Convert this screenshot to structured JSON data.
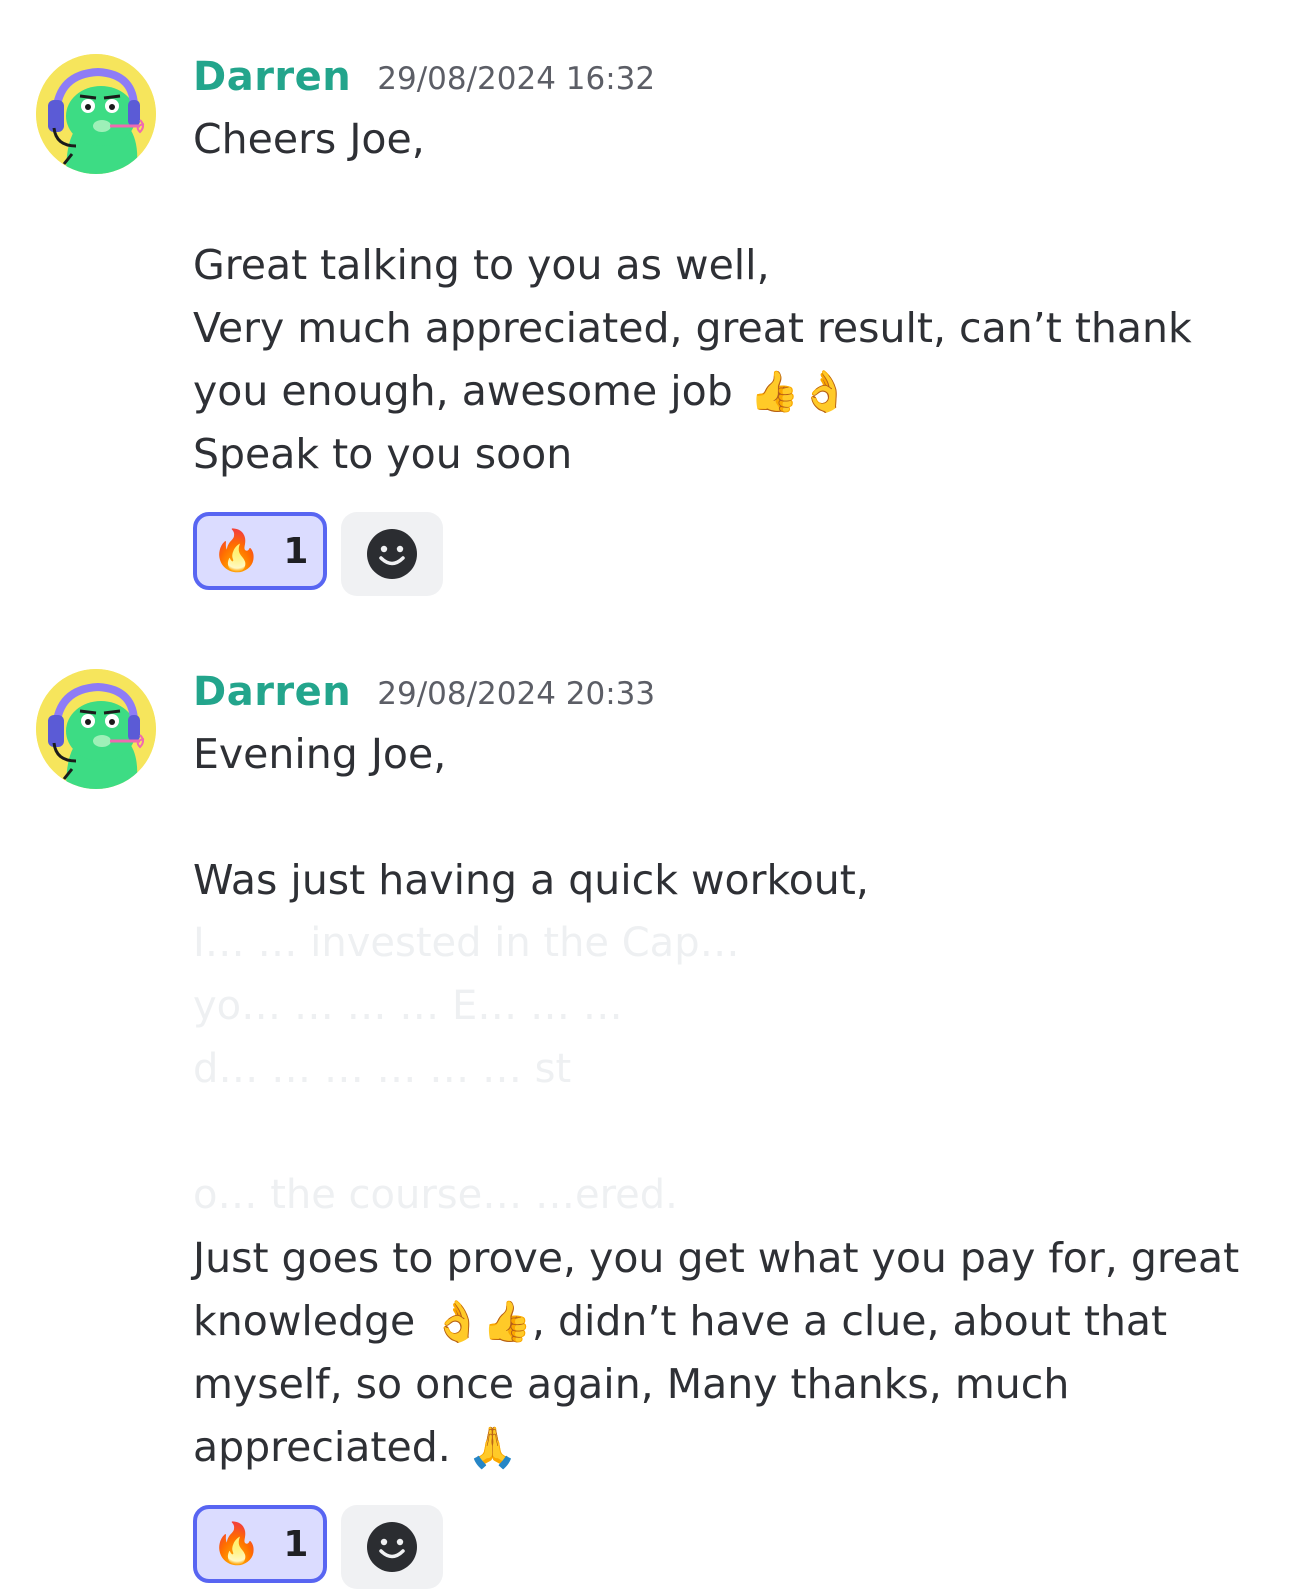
{
  "messages": [
    {
      "author": "Darren",
      "timestamp": "29/08/2024 16:32",
      "lines": [
        {
          "text": "Cheers Joe,"
        },
        {
          "text": ""
        },
        {
          "text": "Great talking to you as well,"
        },
        {
          "text": "Very much appreciated, great result, can’t thank"
        },
        {
          "text": "you enough, awesome job",
          "emoji": "👍👌"
        },
        {
          "text": "Speak to you soon"
        }
      ],
      "reaction": {
        "emoji": "🔥",
        "count": "1"
      }
    },
    {
      "author": "Darren",
      "timestamp": "29/08/2024 20:33",
      "lines": [
        {
          "text": "Evening Joe,"
        },
        {
          "text": ""
        },
        {
          "text": "Was just having a quick workout,"
        },
        {
          "text": "I… … invested in the Cap…"
        },
        {
          "text": "yo… … … … E… … …"
        },
        {
          "text": "d… … … … … … st"
        },
        {
          "text": ""
        },
        {
          "text": "o… the course… …ered."
        },
        {
          "text": "Just goes to prove, you get what you pay for, great"
        },
        {
          "text": "knowledge",
          "emoji": "👌👍",
          "after": ", didn’t have a clue, about that"
        },
        {
          "text": "myself, so once again, Many thanks, much"
        },
        {
          "text": "appreciated.",
          "emoji": "🙏"
        }
      ],
      "reaction": {
        "emoji": "🔥",
        "count": "1"
      }
    }
  ],
  "colors": {
    "username": "#23a58c",
    "reaction_border": "#5865f2",
    "reaction_bg": "#dbdcff",
    "add_reaction_bg": "#f0f1f3"
  },
  "icons": {
    "avatar": "green-character-headset-avatar",
    "add_reaction": "add-reaction-smile-icon"
  }
}
